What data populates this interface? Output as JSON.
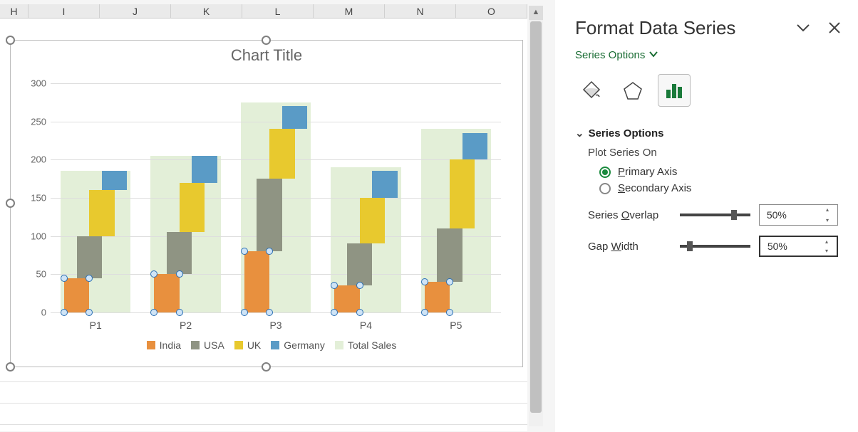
{
  "columns": [
    "H",
    "I",
    "J",
    "K",
    "L",
    "M",
    "N",
    "O"
  ],
  "panel": {
    "title": "Format Data Series",
    "subLink": "Series Options",
    "section": "Series Options",
    "plotOn": "Plot Series On",
    "primary": "rimary Axis",
    "primaryU": "P",
    "secondary": "econdary Axis",
    "secondaryU": "S",
    "overlap": "Series Overlap",
    "overlapU": "O",
    "overlapVal": "50%",
    "gap": "Gap Width",
    "gapU": "W",
    "gapVal": "50%"
  },
  "chart_data": {
    "type": "bar",
    "title": "Chart Title",
    "ylabel": "",
    "xlabel": "",
    "ylim": [
      0,
      300
    ],
    "yticks": [
      0,
      50,
      100,
      150,
      200,
      250,
      300
    ],
    "categories": [
      "P1",
      "P2",
      "P3",
      "P4",
      "P5"
    ],
    "series": [
      {
        "name": "India",
        "color": "#e8903e",
        "values": [
          45,
          50,
          80,
          35,
          40
        ]
      },
      {
        "name": "USA",
        "color": "#8f9483",
        "values": [
          55,
          55,
          95,
          55,
          70
        ]
      },
      {
        "name": "UK",
        "color": "#e8c92e",
        "values": [
          60,
          65,
          65,
          60,
          90
        ]
      },
      {
        "name": "Germany",
        "color": "#5a9bc6",
        "values": [
          25,
          35,
          30,
          35,
          35
        ]
      },
      {
        "name": "Total Sales",
        "color": "#e3efd8",
        "values": [
          185,
          205,
          275,
          190,
          240
        ]
      }
    ],
    "legend_position": "bottom",
    "overlap_pct": 50,
    "gap_pct": 50
  }
}
